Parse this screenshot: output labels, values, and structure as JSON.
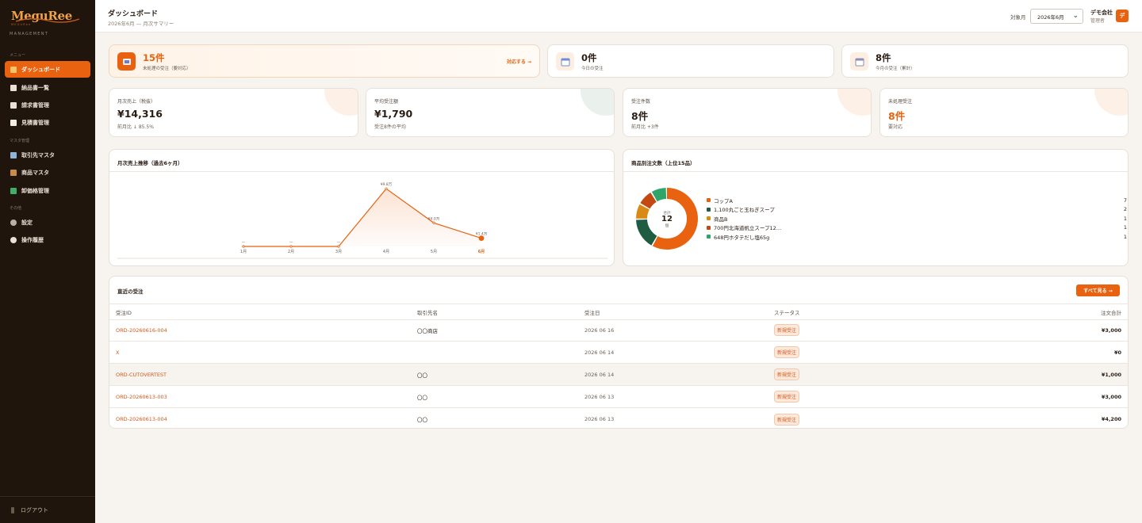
{
  "sidebar": {
    "logo": "MeguRee",
    "logo_tag": "MEGURee",
    "logo_sub": "MANAGEMENT",
    "sections": {
      "menu": "メニュー",
      "master": "マスタ管理",
      "other": "その他"
    },
    "items": [
      {
        "label": "ダッシュボード",
        "icon": "dashboard-icon"
      },
      {
        "label": "納品書一覧",
        "icon": "document-icon"
      },
      {
        "label": "請求書管理",
        "icon": "invoice-icon"
      },
      {
        "label": "見積書管理",
        "icon": "estimate-icon"
      },
      {
        "label": "取引先マスタ",
        "icon": "building-icon"
      },
      {
        "label": "商品マスタ",
        "icon": "box-icon"
      },
      {
        "label": "卸価格管理",
        "icon": "price-tag-icon"
      },
      {
        "label": "設定",
        "icon": "gear-icon"
      },
      {
        "label": "操作履歴",
        "icon": "clock-icon"
      }
    ],
    "logout": "ログアウト"
  },
  "header": {
    "title": "ダッシュボード",
    "subtitle": "2026年6月 — 月次サマリー",
    "period_label": "対象月",
    "period_value": "2026年6月",
    "user_name": "デモ会社",
    "user_role": "管理者",
    "avatar": "デ"
  },
  "kpis": [
    {
      "value": "15件",
      "label": "未処理の受注（要対応）",
      "link": "対応する →"
    },
    {
      "value": "0件",
      "label": "今日の受注"
    },
    {
      "value": "8件",
      "label": "今月の受注（累計）"
    }
  ],
  "stats": [
    {
      "label": "月次売上（税抜）",
      "value": "¥14,316",
      "sub": "前月比 ↓ 85.5%"
    },
    {
      "label": "平均受注額",
      "value": "¥1,790",
      "sub": "受注8件の平均"
    },
    {
      "label": "受注件数",
      "value": "8件",
      "sub": "前月比 +3件"
    },
    {
      "label": "未処理受注",
      "value": "8件",
      "sub": "要対応"
    }
  ],
  "colors": {
    "accent": "#e8620f",
    "dark": "#1f150d",
    "green_dark": "#1f5c42",
    "amber": "#d98a14",
    "red": "#c24a12",
    "green": "#2fa56a"
  },
  "line_chart": {
    "title": "月次売上推移（過去6ヶ月）",
    "chart_data": {
      "type": "line",
      "categories": [
        "1月",
        "2月",
        "3月",
        "4月",
        "5月",
        "6月"
      ],
      "values": [
        0,
        0,
        0,
        9.8,
        4.0,
        1.4
      ],
      "labels": [
        "—",
        "—",
        "—",
        "¥9.8万",
        "¥4.0万",
        "¥1.4万"
      ],
      "unit": "万円",
      "ylim": [
        0,
        10.5
      ],
      "highlight_index": 5
    }
  },
  "donut_chart": {
    "title": "商品別注文数（上位15品）",
    "center_label": "合計",
    "center_value": "12",
    "center_unit": "個",
    "chart_data": {
      "type": "pie",
      "categories": [
        "コップA",
        "1,100丸ごと玉ねぎスープ",
        "商品B",
        "700円北海道帆立スープ12…",
        "648円ホタテだし塩65g"
      ],
      "values": [
        7,
        2,
        1,
        1,
        1
      ],
      "colors": [
        "#e8620f",
        "#1f5c42",
        "#d98a14",
        "#c24a12",
        "#2fa56a"
      ]
    }
  },
  "orders": {
    "title": "直近の受注",
    "see_all": "すべて見る →",
    "columns": [
      "受注ID",
      "取引先名",
      "受注日",
      "ステータス",
      "注文合計"
    ],
    "rows": [
      {
        "id": "ORD-20260616-004",
        "customer": "〇〇商店",
        "date": "2026 06 16",
        "status": "新規受注",
        "total": "¥3,000"
      },
      {
        "id": "X",
        "customer": "",
        "date": "2026 06 14",
        "status": "新規受注",
        "total": "¥0"
      },
      {
        "id": "ORD-CUTOVERTEST",
        "customer": "〇〇",
        "date": "2026 06 14",
        "status": "新規受注",
        "total": "¥1,000"
      },
      {
        "id": "ORD-20260613-003",
        "customer": "〇〇",
        "date": "2026 06 13",
        "status": "新規受注",
        "total": "¥3,000"
      },
      {
        "id": "ORD-20260613-004",
        "customer": "〇〇",
        "date": "2026 06 13",
        "status": "新規受注",
        "total": "¥4,200"
      }
    ]
  }
}
